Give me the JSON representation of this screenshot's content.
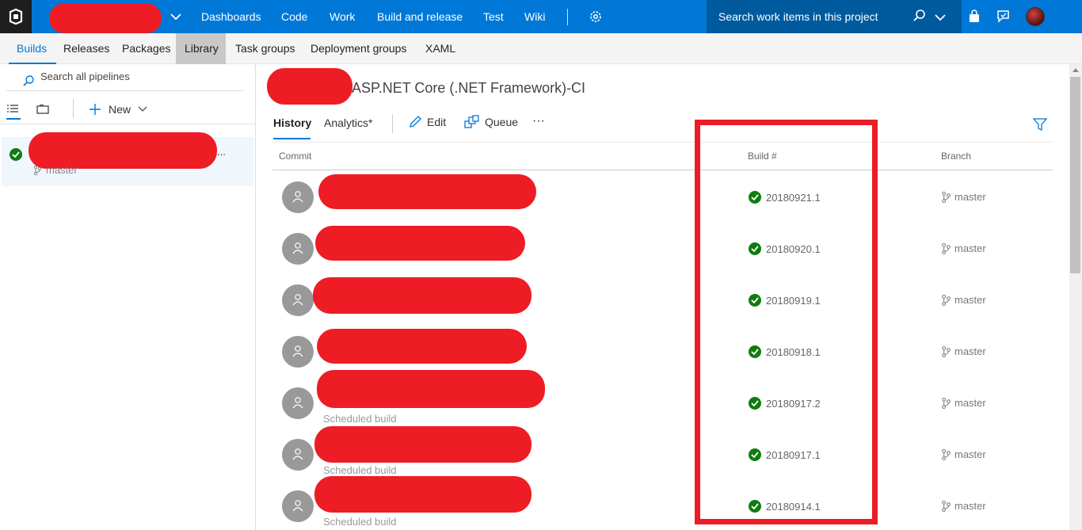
{
  "topbar": {
    "nav": [
      "Dashboards",
      "Code",
      "Work",
      "Build and release",
      "Test",
      "Wiki"
    ],
    "search_placeholder": "Search work items in this project"
  },
  "subnav": {
    "tabs": [
      "Builds",
      "Releases",
      "Packages",
      "Library",
      "Task groups",
      "Deployment groups",
      "XAML"
    ],
    "active": "Builds",
    "hovered": "Library"
  },
  "left": {
    "search_placeholder": "Search all pipelines",
    "new_label": "New",
    "pipeline": {
      "branch": "master",
      "more": "..."
    }
  },
  "main": {
    "title_suffix": "ASP.NET Core (.NET Framework)-CI",
    "pivots": {
      "history": "History",
      "analytics": "Analytics*"
    },
    "actions": {
      "edit": "Edit",
      "queue": "Queue",
      "more": "···"
    },
    "columns": {
      "commit": "Commit",
      "build": "Build #",
      "branch": "Branch"
    },
    "rows": [
      {
        "subtitle": "",
        "build": "20180921.1",
        "branch": "master"
      },
      {
        "subtitle": "",
        "build": "20180920.1",
        "branch": "master"
      },
      {
        "subtitle": "",
        "build": "20180919.1",
        "branch": "master"
      },
      {
        "subtitle": "",
        "build": "20180918.1",
        "branch": "master"
      },
      {
        "subtitle": "Scheduled build",
        "build": "20180917.2",
        "branch": "master"
      },
      {
        "subtitle": "Scheduled build",
        "build": "20180917.1",
        "branch": "master"
      },
      {
        "subtitle": "Scheduled build",
        "build": "20180914.1",
        "branch": "master"
      }
    ]
  },
  "colors": {
    "accent": "#0078d7",
    "success": "#107c10",
    "redaction": "#ee1c24"
  }
}
